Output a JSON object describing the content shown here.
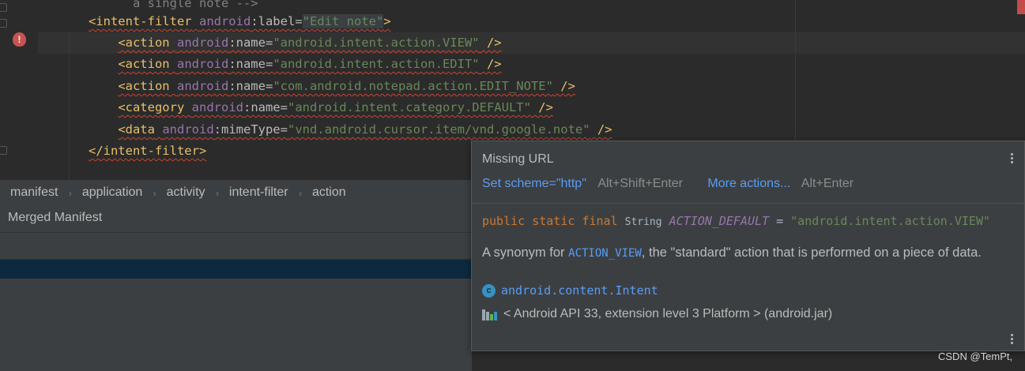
{
  "editor": {
    "comment_fragment": "a single note -->",
    "line_filter": {
      "tag": "<intent-filter",
      "ns": "android",
      "attr": ":label=",
      "value": "\"Edit note\"",
      "close": ">"
    },
    "line_action1": {
      "tag": "<action",
      "ns": "android",
      "attr": ":name=",
      "value": "\"android.intent.action.VIEW\"",
      "close": " />"
    },
    "line_action2": {
      "tag": "<action",
      "ns": "android",
      "attr": ":name=",
      "value": "\"android.intent.action.EDIT\"",
      "close": " />"
    },
    "line_action3": {
      "tag": "<action",
      "ns": "android",
      "attr": ":name=",
      "value": "\"com.android.notepad.action.EDIT_NOTE\"",
      "close": " />"
    },
    "line_category": {
      "tag": "<category",
      "ns": "android",
      "attr": ":name=",
      "value": "\"android.intent.category.DEFAULT\"",
      "close": " />"
    },
    "line_data": {
      "tag": "<data",
      "ns": "android",
      "attr": ":mimeType=",
      "value": "\"vnd.android.cursor.item/vnd.google.note\"",
      "close": " />"
    },
    "line_close": {
      "tag": "</intent-filter>"
    },
    "error_glyph": "!"
  },
  "breadcrumb": {
    "items": [
      "manifest",
      "application",
      "activity",
      "intent-filter",
      "action"
    ],
    "separator": "›"
  },
  "bottom_panel": {
    "tab_label": "Merged Manifest"
  },
  "popup": {
    "title": "Missing URL",
    "fix_label": "Set scheme=\"http\"",
    "fix_shortcut": "Alt+Shift+Enter",
    "more_label": "More actions...",
    "more_shortcut": "Alt+Enter",
    "declaration": {
      "modifiers": "public static final",
      "type": "String",
      "name": "ACTION_DEFAULT",
      "equals": "=",
      "value": "\"android.intent.action.VIEW\""
    },
    "doc": {
      "prefix": "A synonym for ",
      "ref": "ACTION_VIEW",
      "suffix": ", the \"standard\" action that is performed on a piece of data."
    },
    "class_icon_letter": "c",
    "class_name": "android.content.Intent",
    "library": "< Android API 33, extension level 3 Platform > (android.jar)"
  },
  "watermark": "CSDN @TemPt,",
  "colors": {
    "editor_bg": "#2b2b2b",
    "panel_bg": "#3c3f41",
    "tag": "#e8bf6a",
    "namespace": "#9876aa",
    "string": "#6a8759",
    "keyword": "#cc7832",
    "link": "#589df6",
    "error": "#c75450",
    "selection": "#0d293e"
  },
  "icons": [
    "error-icon",
    "class-icon",
    "library-icon",
    "more-options-icon",
    "chevron-right-icon"
  ]
}
